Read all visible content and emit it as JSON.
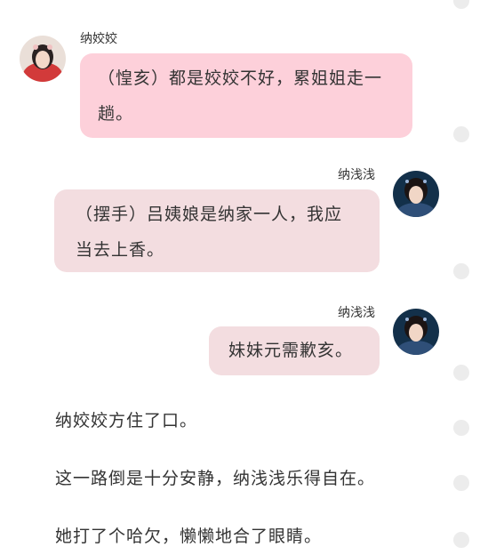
{
  "messages": [
    {
      "sender": "纳姣姣",
      "text": "（惶亥）都是姣姣不好，累姐姐走一趟。",
      "bubble_color": "#fdd0da"
    },
    {
      "sender": "纳浅浅",
      "text": "（摆手）吕姨娘是纳家一人，我应当去上香。",
      "bubble_color": "#f3dde0"
    },
    {
      "sender": "纳浅浅",
      "text": "妹妹元需歉亥。",
      "bubble_color": "#f3dde0"
    }
  ],
  "narration": [
    "纳姣姣方住了口。",
    "这一路倒是十分安静，纳浅浅乐得自在。",
    "她打了个哈欠，懒懒地合了眼睛。"
  ]
}
